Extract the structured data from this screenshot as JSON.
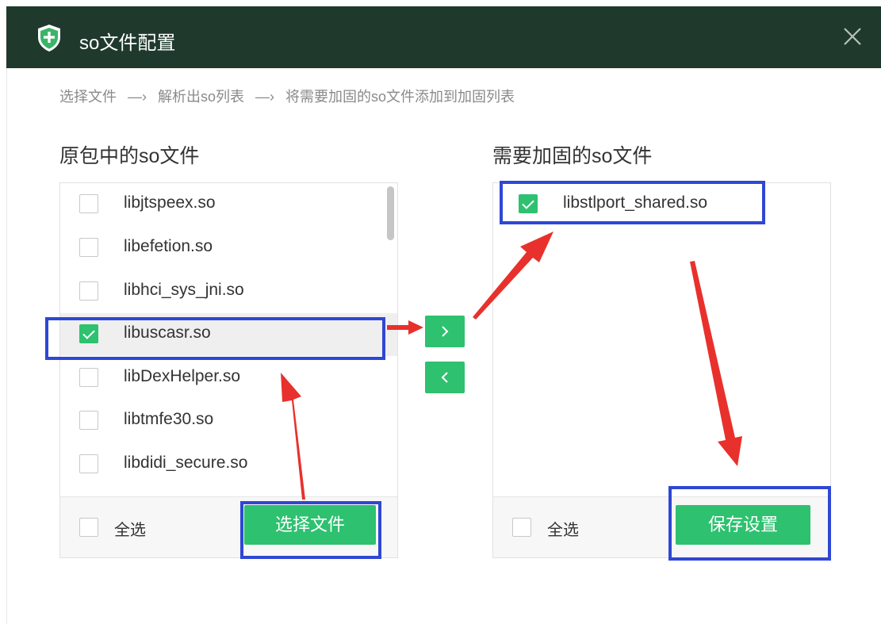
{
  "window": {
    "title": "so文件配置"
  },
  "steps": [
    "选择文件",
    "解析出so列表",
    "将需要加固的so文件添加到加固列表"
  ],
  "step_arrow": "—›",
  "left": {
    "heading": "原包中的so文件",
    "items": [
      {
        "name": "libjtspeex.so",
        "checked": false
      },
      {
        "name": "libefetion.so",
        "checked": false
      },
      {
        "name": "libhci_sys_jni.so",
        "checked": false
      },
      {
        "name": "libuscasr.so",
        "checked": true
      },
      {
        "name": "libDexHelper.so",
        "checked": false
      },
      {
        "name": "libtmfe30.so",
        "checked": false
      },
      {
        "name": "libdidi_secure.so",
        "checked": false
      }
    ],
    "select_all_label": "全选",
    "select_file_button": "选择文件"
  },
  "right": {
    "heading": "需要加固的so文件",
    "items": [
      {
        "name": "libstlport_shared.so",
        "checked": true
      }
    ],
    "select_all_label": "全选",
    "save_button": "保存设置"
  },
  "colors": {
    "titlebar": "#1f3a2c",
    "accent_green": "#2ec16f",
    "highlight_blue": "#2f47d4",
    "annotation_red": "#e8312c"
  },
  "icons": {
    "app": "shield-plus-icon",
    "close": "close-icon",
    "move_right": "chevron-right-icon",
    "move_left": "chevron-left-icon"
  }
}
